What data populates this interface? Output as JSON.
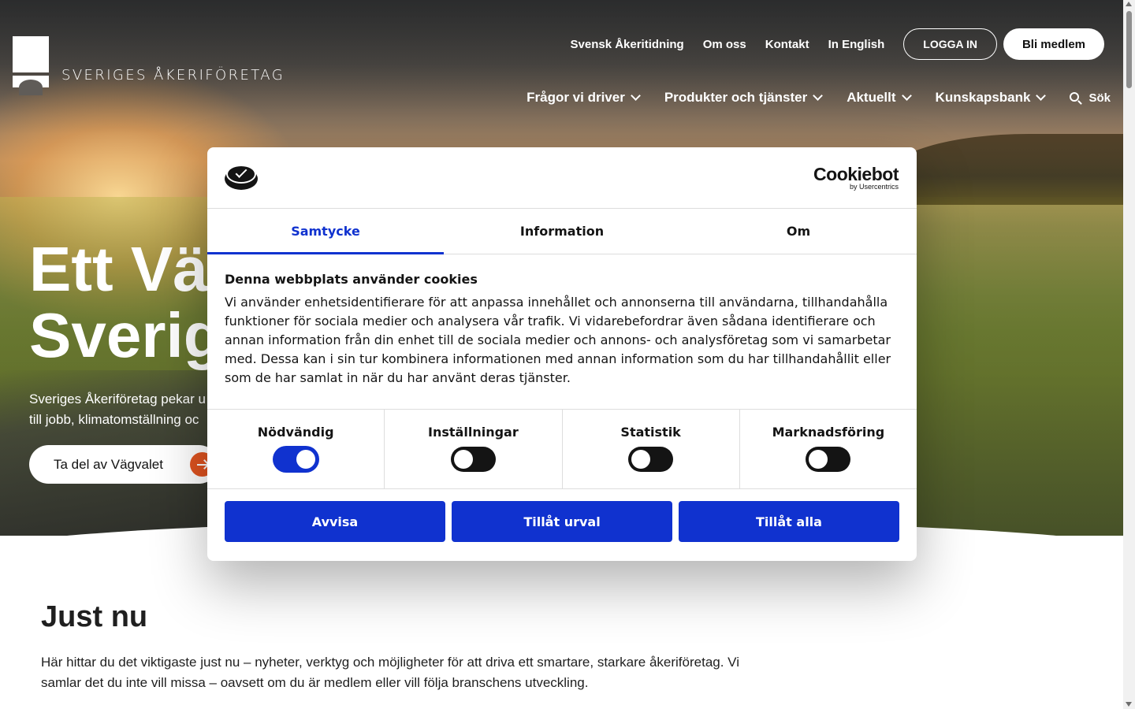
{
  "header": {
    "logo_text": "SVERIGES ÅKERIFÖRETAG",
    "top_links": [
      "Svensk Åkeritidning",
      "Om oss",
      "Kontakt",
      "In English"
    ],
    "login_label": "LOGGA IN",
    "member_label": "Bli medlem",
    "nav": [
      "Frågor vi driver",
      "Produkter och tjänster",
      "Aktuellt",
      "Kunskapsbank"
    ],
    "search_label": "Sök"
  },
  "hero": {
    "title_line1": "Ett Vä",
    "title_line2": "Sverig",
    "subtitle_line1": "Sveriges Åkeriföretag pekar u",
    "subtitle_line2": "till jobb, klimatomställning oc",
    "cta_label": "Ta del av Vägvalet"
  },
  "justnu": {
    "title": "Just nu",
    "text": "Här hittar du det viktigaste just nu – nyheter, verktyg och möjligheter för att driva ett smartare, starkare åkeriföretag. Vi samlar det du inte vill missa – oavsett om du är medlem eller vill följa branschens utveckling."
  },
  "cookie": {
    "brand": "Cookiebot",
    "brand_sub": "by Usercentrics",
    "tabs": [
      "Samtycke",
      "Information",
      "Om"
    ],
    "heading": "Denna webbplats använder cookies",
    "body": "Vi använder enhetsidentifierare för att anpassa innehållet och annonserna till användarna, tillhandahålla funktioner för sociala medier och analysera vår trafik. Vi vidarebefordrar även sådana identifierare och annan information från din enhet till de sociala medier och annons- och analysföretag som vi samarbetar med. Dessa kan i sin tur kombinera informationen med annan information som du har tillhandahållit eller som de har samlat in när du har använt deras tjänster.",
    "toggles": [
      {
        "label": "Nödvändig",
        "on": true
      },
      {
        "label": "Inställningar",
        "on": false
      },
      {
        "label": "Statistik",
        "on": false
      },
      {
        "label": "Marknadsföring",
        "on": false
      }
    ],
    "buttons": [
      "Avvisa",
      "Tillåt urval",
      "Tillåt alla"
    ],
    "accent_color": "#1032cf"
  }
}
